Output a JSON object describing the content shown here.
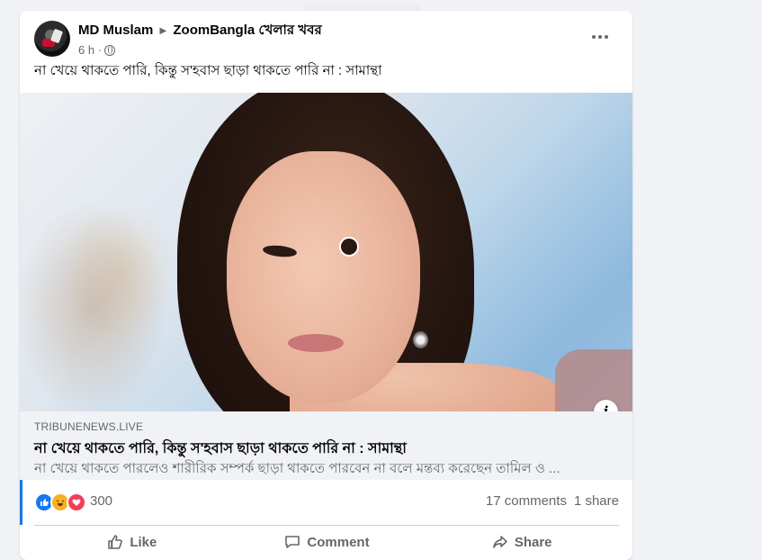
{
  "post": {
    "author": "MD Muslam",
    "group": "ZoomBangla খেলার খবর",
    "time": "6 h ·",
    "text": "না খেয়ে থাকতে পারি, কিন্তু স'হবাস ছাড়া থাকতে পারি না : সামান্থা"
  },
  "link": {
    "domain": "TRIBUNENEWS.LIVE",
    "title": "না খেয়ে থাকতে পারি, কিন্তু স'হবাস ছাড়া থাকতে পারি না : সামান্থা",
    "description": "না খেয়ে থাকতে পারলেও শারীরিক সম্পর্ক ছাড়া থাকতে পারবেন না বলে মন্তব্য করেছেন তামিল ও ...",
    "info_icon": "i"
  },
  "stats": {
    "reactions": [
      "like-icon",
      "haha-icon",
      "love-icon"
    ],
    "reaction_count": "300",
    "comments": "17 comments",
    "shares": "1 share"
  },
  "actions": {
    "like": "Like",
    "comment": "Comment",
    "share": "Share"
  },
  "colors": {
    "accent": "#1877f2",
    "text": "#050505",
    "secondary": "#65676b",
    "page_bg": "#f0f2f5"
  }
}
